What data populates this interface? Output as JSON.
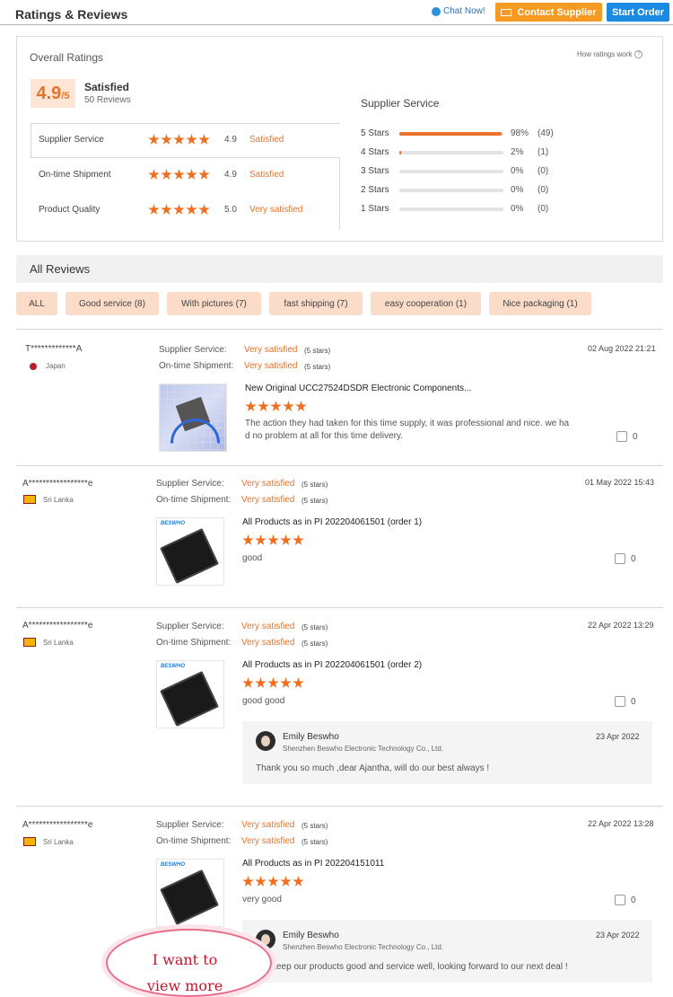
{
  "header": {
    "title": "Ratings & Reviews",
    "chat_label": "Chat Now!",
    "contact_label": "Contact Supplier",
    "order_label": "Start Order"
  },
  "overall": {
    "title": "Overall Ratings",
    "how_label": "How ratings work",
    "score": "4.9",
    "score_suffix": "/5",
    "satisfaction": "Satisfied",
    "reviews_count": "50 Reviews",
    "rows": [
      {
        "label": "Supplier Service",
        "stars": 5,
        "score": "4.9",
        "status": "Satisfied"
      },
      {
        "label": "On-time Shipment",
        "stars": 5,
        "score": "4.9",
        "status": "Satisfied"
      },
      {
        "label": "Product Quality",
        "stars": 5,
        "score": "5.0",
        "status": "Very satisfied"
      }
    ]
  },
  "supplier_service": {
    "title": "Supplier Service",
    "bars": [
      {
        "label": "5  Stars",
        "fraction": 0.98,
        "pct": "98%",
        "count": "(49)"
      },
      {
        "label": "4  Stars",
        "fraction": 0.02,
        "pct": "2%",
        "count": "(1)"
      },
      {
        "label": "3  Stars",
        "fraction": 0,
        "pct": "0%",
        "count": "(0)"
      },
      {
        "label": "2  Stars",
        "fraction": 0,
        "pct": "0%",
        "count": "(0)"
      },
      {
        "label": "1  Stars",
        "fraction": 0,
        "pct": "0%",
        "count": "(0)"
      }
    ]
  },
  "all_reviews": {
    "title": "All Reviews",
    "tags": [
      "ALL",
      "Good service (8)",
      "With pictures (7)",
      "fast shipping (7)",
      "easy cooperation (1)",
      "Nice packaging (1)"
    ]
  },
  "reviews": [
    {
      "user": "T*************A",
      "country": "Japan",
      "service_label": "Supplier Service:",
      "service_value": "Very satisfied",
      "service_stars": "(5 stars)",
      "shipment_label": "On-time Shipment:",
      "shipment_value": "Very satisfied",
      "shipment_stars": "(5 stars)",
      "date": "02 Aug 2022 21:21",
      "product": "New Original UCC27524DSDR Electronic Components...",
      "rating": 5,
      "text_line1": "The action they had taken for this time supply, it was professional and nice. we ha",
      "text_line2": "d no problem at all for this time delivery.",
      "likes": "0"
    },
    {
      "user": "A*****************e",
      "country": "Sri Lanka",
      "service_label": "Supplier Service:",
      "service_value": "Very satisfied",
      "service_stars": "(5 stars)",
      "shipment_label": "On-time Shipment:",
      "shipment_value": "Very satisfied",
      "shipment_stars": "(5 stars)",
      "date": "01 May 2022 15:43",
      "product": "All Products as in PI 202204061501 (order 1)",
      "rating": 5,
      "text": "good",
      "likes": "0"
    },
    {
      "user": "A*****************e",
      "country": "Sri Lanka",
      "service_label": "Supplier Service:",
      "service_value": "Very satisfied",
      "service_stars": "(5 stars)",
      "shipment_label": "On-time Shipment:",
      "shipment_value": "Very satisfied",
      "shipment_stars": "(5 stars)",
      "date": "22 Apr 2022 13:29",
      "product": "All Products as in PI 202204061501 (order 2)",
      "rating": 5,
      "text": "good good",
      "likes": "0",
      "reply": {
        "name": "Emily Beswho",
        "company": "Shenzhen Beswho Electronic Technology Co., Ltd.",
        "date": "23 Apr 2022",
        "text": "Thank you so much ,dear Ajantha, will do our best always !"
      }
    },
    {
      "user": "A*****************e",
      "country": "Sri Lanka",
      "service_label": "Supplier Service:",
      "service_value": "Very satisfied",
      "service_stars": "(5 stars)",
      "shipment_label": "On-time Shipment:",
      "shipment_value": "Very satisfied",
      "shipment_stars": "(5 stars)",
      "date": "22 Apr 2022 13:28",
      "product": "All Products as in PI 202204151011",
      "rating": 5,
      "text": "very good",
      "likes": "0",
      "reply": {
        "name": "Emily Beswho",
        "company": "Shenzhen Beswho Electronic Technology Co., Ltd.",
        "date": "23 Apr 2022",
        "text": "keep our products good and service well, looking forward to our next deal !"
      }
    }
  ],
  "brand_logo": "BESWHO",
  "bubble": {
    "line1": "I want to",
    "line2": "view more"
  },
  "colors": {
    "accent": "#e8732b",
    "contact": "#f59a23",
    "order": "#1a8be0",
    "tag_bg": "#fbdcc8"
  }
}
